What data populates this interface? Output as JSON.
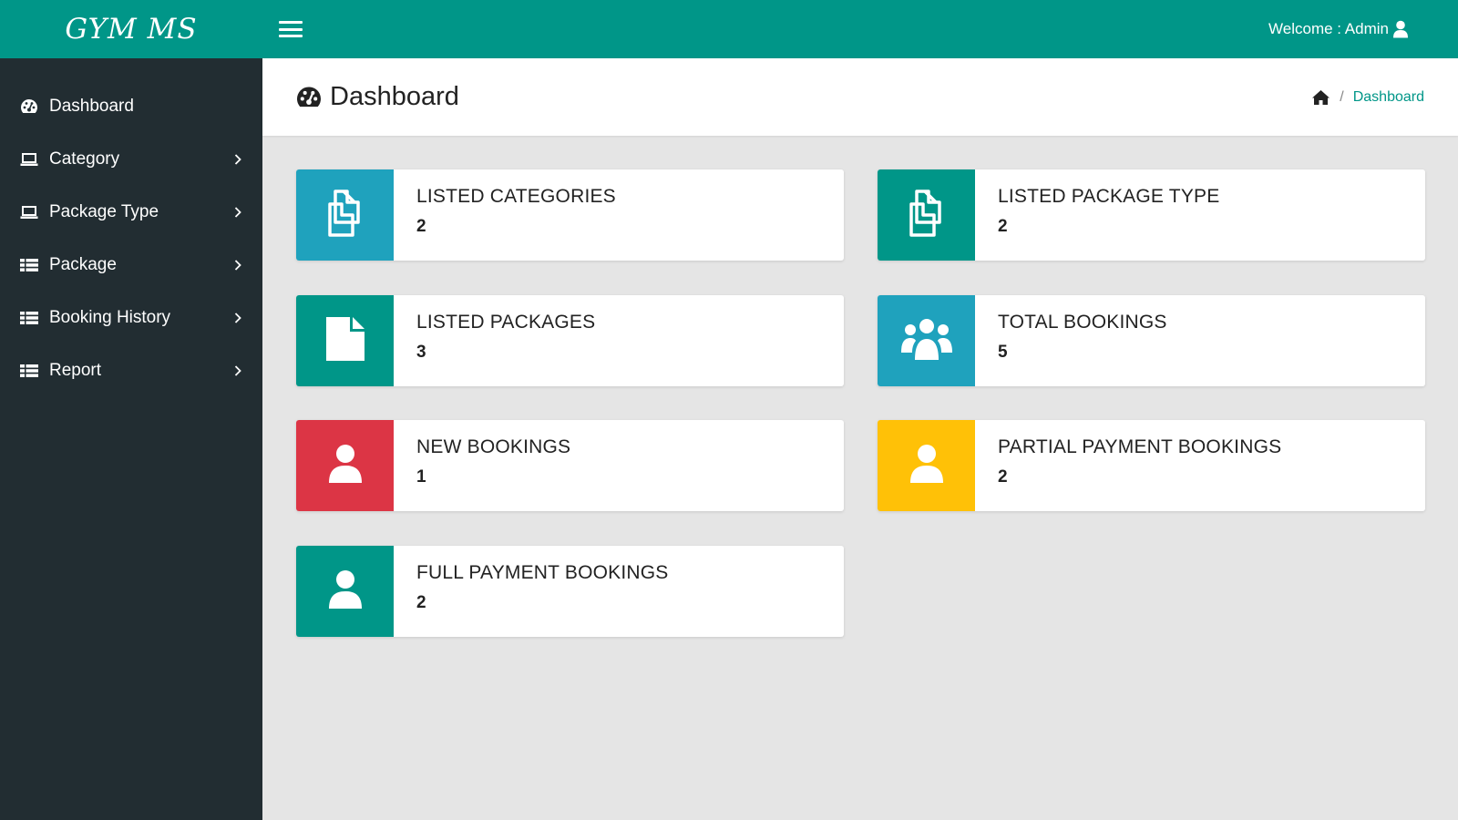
{
  "app": {
    "brand": "GYM MS"
  },
  "header": {
    "welcome_text": "Welcome : Admin"
  },
  "page": {
    "title": "Dashboard",
    "breadcrumb_current": "Dashboard"
  },
  "sidebar": {
    "items": [
      {
        "label": "Dashboard",
        "icon": "dashboard-icon"
      },
      {
        "label": "Category",
        "icon": "laptop-icon"
      },
      {
        "label": "Package Type",
        "icon": "laptop-icon"
      },
      {
        "label": "Package",
        "icon": "list-icon"
      },
      {
        "label": "Booking History",
        "icon": "list-icon"
      },
      {
        "label": "Report",
        "icon": "list-icon"
      }
    ]
  },
  "widgets": [
    {
      "title": "LISTED CATEGORIES",
      "value": "2",
      "color": "#1fa2bd",
      "icon": "files-icon"
    },
    {
      "title": "LISTED PACKAGE TYPE",
      "value": "2",
      "color": "#009688",
      "icon": "files-icon"
    },
    {
      "title": "LISTED PACKAGES",
      "value": "3",
      "color": "#009688",
      "icon": "file-icon"
    },
    {
      "title": "TOTAL BOOKINGS",
      "value": "5",
      "color": "#1fa2bd",
      "icon": "users-icon"
    },
    {
      "title": "NEW BOOKINGS",
      "value": "1",
      "color": "#dc3545",
      "icon": "user-icon"
    },
    {
      "title": "PARTIAL PAYMENT BOOKINGS",
      "value": "2",
      "color": "#ffc107",
      "icon": "user-icon"
    },
    {
      "title": "FULL PAYMENT BOOKINGS",
      "value": "2",
      "color": "#009688",
      "icon": "user-icon"
    }
  ],
  "colors": {
    "primary": "#009688",
    "sidebar_bg": "#222d32",
    "content_bg": "#e5e5e5"
  }
}
